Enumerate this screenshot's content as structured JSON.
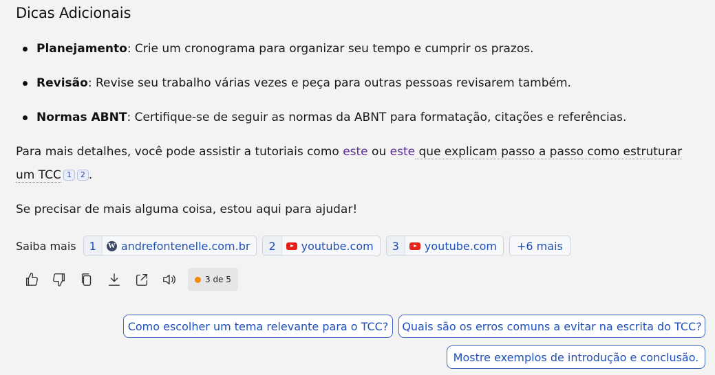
{
  "section": {
    "heading": "Dicas Adicionais",
    "tips": [
      {
        "title": "Planejamento",
        "text": ": Crie um cronograma para organizar seu tempo e cumprir os prazos."
      },
      {
        "title": "Revisão",
        "text": ": Revise seu trabalho várias vezes e peça para outras pessoas revisarem também."
      },
      {
        "title": "Normas ABNT",
        "text": ": Certifique-se de seguir as normas da ABNT para formatação, citações e referências."
      }
    ]
  },
  "details": {
    "prefix": "Para mais detalhes, você pode assistir a tutoriais como ",
    "link1": "este",
    "middle": " ou ",
    "link2": "este",
    "suffix": " que explicam passo a passo como estruturar um TCC",
    "cit1": "1",
    "cit2": "2",
    "end": "."
  },
  "closing": "Se precisar de mais alguma coisa, estou aqui para ajudar!",
  "learn_more": {
    "label": "Saiba mais",
    "sources": [
      {
        "num": "1",
        "site": "andrefontenelle.com.br",
        "icon": "wordpress-icon"
      },
      {
        "num": "2",
        "site": "youtube.com",
        "icon": "youtube-icon"
      },
      {
        "num": "3",
        "site": "youtube.com",
        "icon": "youtube-icon"
      }
    ],
    "more": "+6 mais"
  },
  "actions": {
    "icons": [
      "thumbs-up-icon",
      "thumbs-down-icon",
      "copy-icon",
      "download-icon",
      "share-icon",
      "speaker-icon"
    ],
    "counter": "3 de 5",
    "counter_color": "#f08c00"
  },
  "suggestions": [
    "Como escolher um tema relevante para o TCC?",
    "Quais são os erros comuns a evitar na escrita do TCC?",
    "Mostre exemplos de introdução e conclusão."
  ]
}
